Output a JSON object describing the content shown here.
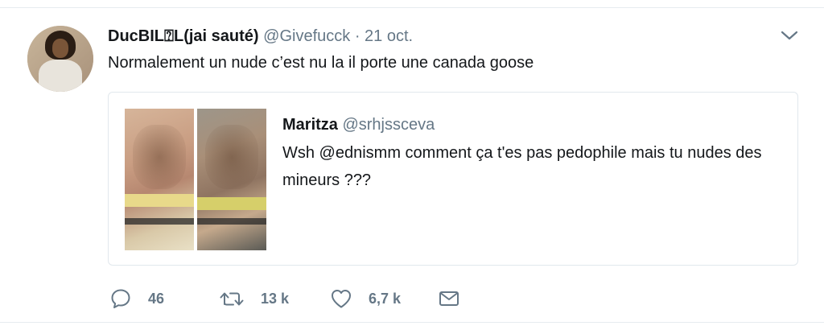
{
  "tweet": {
    "display_name": "DucBIL⍰L(jai sauté)",
    "handle": "@Givefucck",
    "separator": "·",
    "date": "21 oct.",
    "text": "Normalement un nude c’est nu la il porte une canada goose"
  },
  "quoted_tweet": {
    "display_name": "Maritza",
    "handle": "@srhjssceva",
    "text": "Wsh @ednismm comment ça t'es pas pedophile mais tu nudes des mineurs ???"
  },
  "actions": {
    "replies": "46",
    "retweets": "13 k",
    "likes": "6,7 k"
  },
  "icons": {
    "reply": "reply-icon",
    "retweet": "retweet-icon",
    "like": "heart-icon",
    "dm": "envelope-icon",
    "more": "chevron-down-icon"
  },
  "colors": {
    "text_primary": "#14171a",
    "text_secondary": "#657786",
    "border": "#e1e8ed"
  }
}
